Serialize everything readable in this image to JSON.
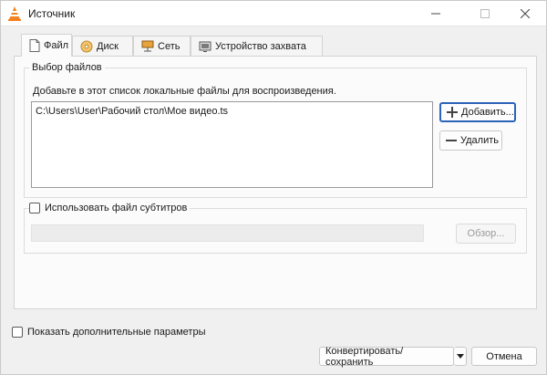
{
  "window": {
    "title": "Источник",
    "accent": "#2a63b8"
  },
  "tabs": [
    {
      "label": "Файл",
      "icon": "file-icon",
      "active": true
    },
    {
      "label": "Диск",
      "icon": "disc-icon",
      "active": false
    },
    {
      "label": "Сеть",
      "icon": "network-icon",
      "active": false
    },
    {
      "label": "Устройство захвата",
      "icon": "capture-device-icon",
      "active": false
    }
  ],
  "file_selection": {
    "group_title": "Выбор файлов",
    "hint": "Добавьте в этот список локальные файлы для воспроизведения.",
    "files": [
      "C:\\Users\\User\\Рабочий стол\\Мое видео.ts"
    ],
    "add_label": "Добавить...",
    "remove_label": "Удалить"
  },
  "subtitles": {
    "checkbox_label": "Использовать файл субтитров",
    "checked": false,
    "path_value": "",
    "browse_label": "Обзор..."
  },
  "footer": {
    "advanced_label": "Показать дополнительные параметры",
    "advanced_checked": false,
    "convert_label": "Конвертировать/сохранить",
    "cancel_label": "Отмена"
  }
}
